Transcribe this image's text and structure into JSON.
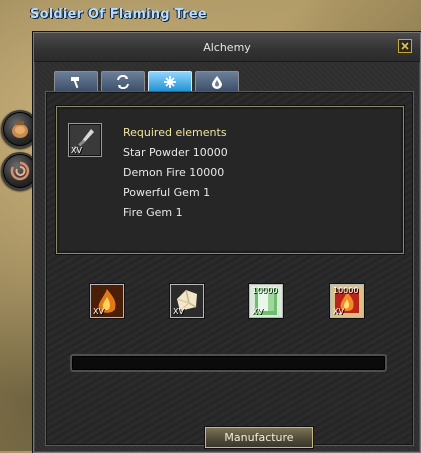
{
  "npc": {
    "name": "Soldier Of Flaming Tree"
  },
  "side_buttons": [
    {
      "icon": "pouch-icon"
    },
    {
      "icon": "swirl-icon"
    }
  ],
  "window": {
    "title": "Alchemy",
    "tabs": [
      {
        "icon": "hammer-icon",
        "active": false
      },
      {
        "icon": "exchange-arrows-icon",
        "active": false
      },
      {
        "icon": "star-burst-icon",
        "active": true
      },
      {
        "icon": "drop-icon",
        "active": false
      }
    ]
  },
  "recipe": {
    "item_badge": "XV",
    "heading": "Required elements",
    "requirements": [
      "Star Powder 10000",
      "Demon Fire 10000",
      "Powerful Gem 1",
      "Fire Gem 1"
    ]
  },
  "materials": [
    {
      "icon": "fire-gem-icon",
      "badge": "XV",
      "count": ""
    },
    {
      "icon": "powerful-gem-icon",
      "badge": "XV",
      "count": ""
    },
    {
      "icon": "star-powder-icon",
      "badge": "XV",
      "count": "10000"
    },
    {
      "icon": "demon-fire-icon",
      "badge": "XV",
      "count": "10000"
    }
  ],
  "progress": {
    "value": 0
  },
  "actions": {
    "manufacture_label": "Manufacture"
  },
  "colors": {
    "npc_name": "#b9ddff",
    "heading": "#f2e5a0",
    "active_tab": "#1f8fcf"
  }
}
